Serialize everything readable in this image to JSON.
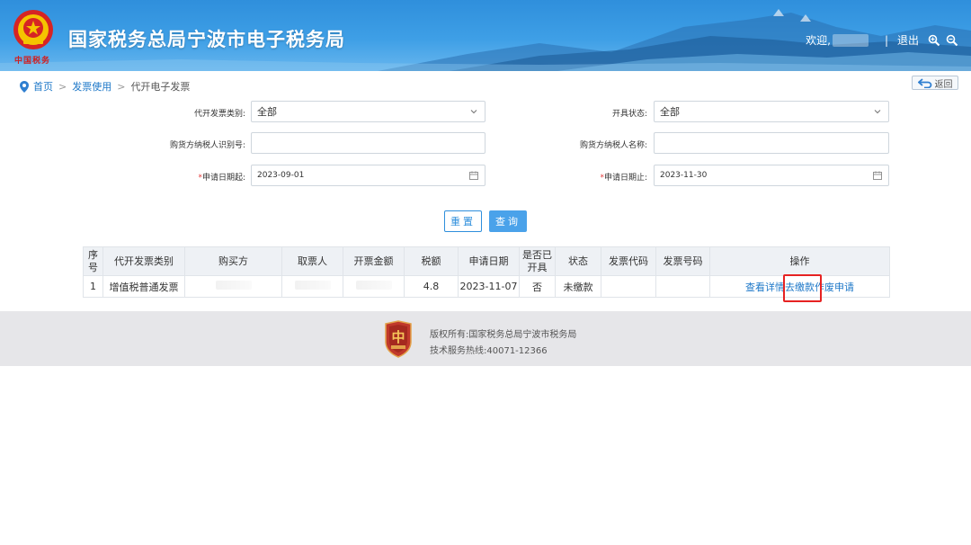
{
  "header": {
    "title": "国家税务总局宁波市电子税务局",
    "emblem_script": "中国税务",
    "welcome": "欢迎,",
    "separator": "|",
    "logout": "退出"
  },
  "breadcrumb": {
    "home": "首页",
    "sep1": ">",
    "section": "发票使用",
    "sep2": ">",
    "current": "代开电子发票",
    "back": "返回"
  },
  "form": {
    "invoice_type_label": "代开发票类别:",
    "invoice_type_value": "全部",
    "status_label": "开具状态:",
    "status_value": "全部",
    "buyer_taxid_label": "购货方纳税人识别号:",
    "buyer_taxid_value": "",
    "buyer_name_label": "购货方纳税人名称:",
    "buyer_name_value": "",
    "required_mark": "*",
    "date_from_label": "申请日期起:",
    "date_from_value": "2023-09-01",
    "date_to_label": "申请日期止:",
    "date_to_value": "2023-11-30"
  },
  "buttons": {
    "reset": "重置",
    "query": "查询"
  },
  "table": {
    "headers": [
      "序号",
      "代开发票类别",
      "购买方",
      "取票人",
      "开票金额",
      "税额",
      "申请日期",
      "是否已开具",
      "状态",
      "发票代码",
      "发票号码",
      "操作"
    ],
    "rows": [
      {
        "index": "1",
        "type": "增值税普通发票",
        "buyer": "",
        "taker": "",
        "amount": "",
        "tax": "4.8",
        "date": "2023-11-07",
        "issued": "否",
        "status": "未缴款",
        "code": "",
        "number": "",
        "op_detail": "查看详情",
        "op_pay": "去缴款",
        "op_void": "作废申请"
      }
    ]
  },
  "footer": {
    "copyright": "版权所有:国家税务总局宁波市税务局",
    "hotline": "技术服务热线:40071-12366"
  },
  "colors": {
    "header_blue": "#3e9fe6",
    "link_blue": "#1e78c8",
    "highlight_red": "#e62222"
  }
}
